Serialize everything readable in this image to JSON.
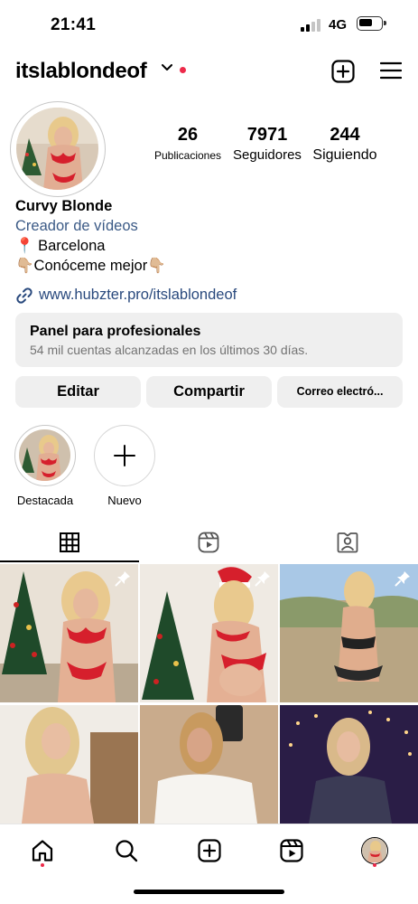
{
  "status_bar": {
    "time": "21:41",
    "network": "4G"
  },
  "header": {
    "username": "itslablondeof"
  },
  "stats": [
    {
      "value": "26",
      "label": "Publicaciones"
    },
    {
      "value": "7971",
      "label": "Seguidores"
    },
    {
      "value": "244",
      "label": "Siguiendo"
    }
  ],
  "bio": {
    "name": "Curvy Blonde",
    "category": "Creador de vídeos",
    "location": "📍 Barcelona",
    "line2_text": "Conóceme mejor",
    "link": "www.hubzter.pro/itslablondeof"
  },
  "dashboard": {
    "title": "Panel para profesionales",
    "subtitle": "54 mil cuentas alcanzadas en los últimos 30 días."
  },
  "buttons": {
    "edit": "Editar",
    "share": "Compartir",
    "email": "Correo electró..."
  },
  "highlights": [
    {
      "label": "Destacada"
    },
    {
      "label": "Nuevo"
    }
  ],
  "tabs": {
    "active": "grid"
  },
  "grid_posts": [
    {
      "pinned": true,
      "theme": "christmas-tree"
    },
    {
      "pinned": true,
      "theme": "christmas-hat"
    },
    {
      "pinned": true,
      "theme": "beach-rocks"
    },
    {
      "pinned": false,
      "theme": "bedroom"
    },
    {
      "pinned": false,
      "theme": "mirror-selfie"
    },
    {
      "pinned": false,
      "theme": "city-lights"
    }
  ],
  "colors": {
    "accent_red": "#ed2a4a",
    "link_blue": "#29497d",
    "category_blue": "#3b5a86",
    "button_gray": "#efefef"
  },
  "icons": {
    "header": [
      "chevron-down-icon",
      "new-post-icon",
      "menu-icon"
    ],
    "tabs": [
      "grid-icon",
      "reels-icon",
      "tagged-icon"
    ],
    "nav": [
      "home-icon",
      "search-icon",
      "create-icon",
      "reels-icon",
      "profile-avatar"
    ]
  }
}
